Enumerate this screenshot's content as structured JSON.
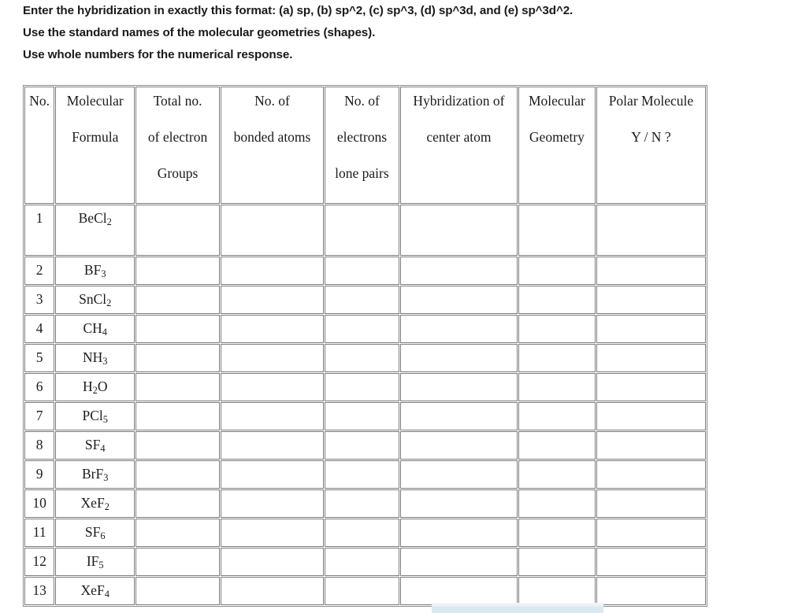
{
  "instructions": [
    "Enter the hybridization in exactly this format: (a) sp, (b) sp^2, (c) sp^3, (d) sp^3d, and (e) sp^3d^2.",
    "Use the standard names of the molecular geometries (shapes).",
    "Use whole numbers for the numerical response."
  ],
  "table": {
    "columns": [
      {
        "key": "no",
        "lines": [
          "No.",
          "",
          ""
        ]
      },
      {
        "key": "formula",
        "lines": [
          "Molecular",
          "Formula",
          ""
        ]
      },
      {
        "key": "groups",
        "lines": [
          "Total no.",
          "of electron",
          "Groups"
        ]
      },
      {
        "key": "bonded",
        "lines": [
          "No. of",
          "bonded atoms",
          ""
        ]
      },
      {
        "key": "lone",
        "lines": [
          "No. of",
          "electrons",
          "lone pairs"
        ]
      },
      {
        "key": "hyb",
        "lines": [
          "Hybridization of",
          "center atom",
          ""
        ]
      },
      {
        "key": "geom",
        "lines": [
          "Molecular",
          "Geometry",
          ""
        ]
      },
      {
        "key": "polar",
        "lines": [
          "Polar Molecule",
          "Y / N ?",
          ""
        ]
      }
    ],
    "rows": [
      {
        "no": "1",
        "formula_main": "BeCl",
        "formula_sub": "2",
        "groups": "",
        "bonded": "",
        "lone": "",
        "hyb": "",
        "geom": "",
        "polar": ""
      },
      {
        "no": "2",
        "formula_main": "BF",
        "formula_sub": "3",
        "groups": "",
        "bonded": "",
        "lone": "",
        "hyb": "",
        "geom": "",
        "polar": ""
      },
      {
        "no": "3",
        "formula_main": "SnCl",
        "formula_sub": "2",
        "groups": "",
        "bonded": "",
        "lone": "",
        "hyb": "",
        "geom": "",
        "polar": ""
      },
      {
        "no": "4",
        "formula_main": "CH",
        "formula_sub": "4",
        "groups": "",
        "bonded": "",
        "lone": "",
        "hyb": "",
        "geom": "",
        "polar": ""
      },
      {
        "no": "5",
        "formula_main": "NH",
        "formula_sub": "3",
        "groups": "",
        "bonded": "",
        "lone": "",
        "hyb": "",
        "geom": "",
        "polar": ""
      },
      {
        "no": "6",
        "formula_main": "H",
        "formula_sub": "2",
        "formula_tail": "O",
        "groups": "",
        "bonded": "",
        "lone": "",
        "hyb": "",
        "geom": "",
        "polar": ""
      },
      {
        "no": "7",
        "formula_main": "PCl",
        "formula_sub": "5",
        "groups": "",
        "bonded": "",
        "lone": "",
        "hyb": "",
        "geom": "",
        "polar": ""
      },
      {
        "no": "8",
        "formula_main": "SF",
        "formula_sub": "4",
        "groups": "",
        "bonded": "",
        "lone": "",
        "hyb": "",
        "geom": "",
        "polar": ""
      },
      {
        "no": "9",
        "formula_main": "BrF",
        "formula_sub": "3",
        "groups": "",
        "bonded": "",
        "lone": "",
        "hyb": "",
        "geom": "",
        "polar": ""
      },
      {
        "no": "10",
        "formula_main": "XeF",
        "formula_sub": "2",
        "groups": "",
        "bonded": "",
        "lone": "",
        "hyb": "",
        "geom": "",
        "polar": ""
      },
      {
        "no": "11",
        "formula_main": "SF",
        "formula_sub": "6",
        "groups": "",
        "bonded": "",
        "lone": "",
        "hyb": "",
        "geom": "",
        "polar": ""
      },
      {
        "no": "12",
        "formula_main": "IF",
        "formula_sub": "5",
        "groups": "",
        "bonded": "",
        "lone": "",
        "hyb": "",
        "geom": "",
        "polar": ""
      },
      {
        "no": "13",
        "formula_main": "XeF",
        "formula_sub": "4",
        "groups": "",
        "bonded": "",
        "lone": "",
        "hyb": "",
        "geom": "",
        "polar": ""
      }
    ]
  },
  "colors": {
    "page_background": "#ffffff",
    "table_border": "#7d7d7d",
    "text": "#1b1b1b",
    "bottom_bar": "#dbe9ee"
  }
}
